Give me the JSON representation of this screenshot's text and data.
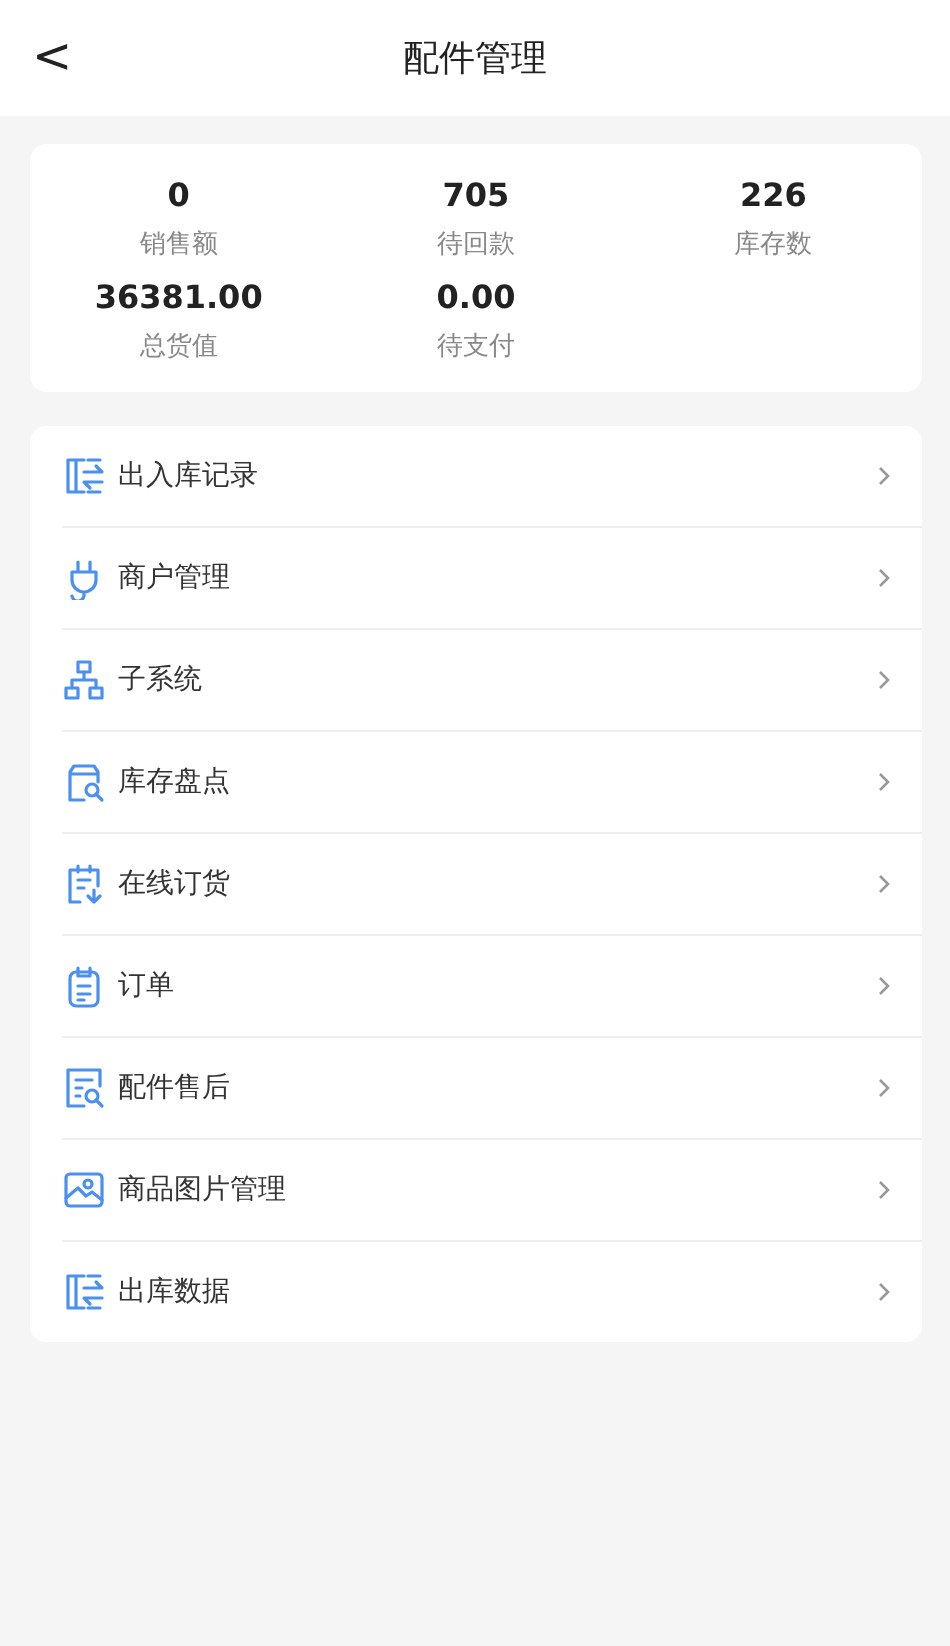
{
  "header": {
    "back": "<",
    "title": "配件管理"
  },
  "stats": [
    {
      "value": "0",
      "label": "销售额"
    },
    {
      "value": "705",
      "label": "待回款"
    },
    {
      "value": "226",
      "label": "库存数"
    },
    {
      "value": "36381.00",
      "label": "总货值"
    },
    {
      "value": "0.00",
      "label": "待支付"
    }
  ],
  "menu": [
    {
      "label": "出入库记录",
      "kind": "transfer"
    },
    {
      "label": "商户管理",
      "kind": "plug"
    },
    {
      "label": "子系统",
      "kind": "tree"
    },
    {
      "label": "库存盘点",
      "kind": "inventory"
    },
    {
      "label": "在线订货",
      "kind": "order"
    },
    {
      "label": "订单",
      "kind": "clipboard"
    },
    {
      "label": "配件售后",
      "kind": "inspect"
    },
    {
      "label": "商品图片管理",
      "kind": "image"
    },
    {
      "label": "出库数据",
      "kind": "transfer"
    }
  ]
}
